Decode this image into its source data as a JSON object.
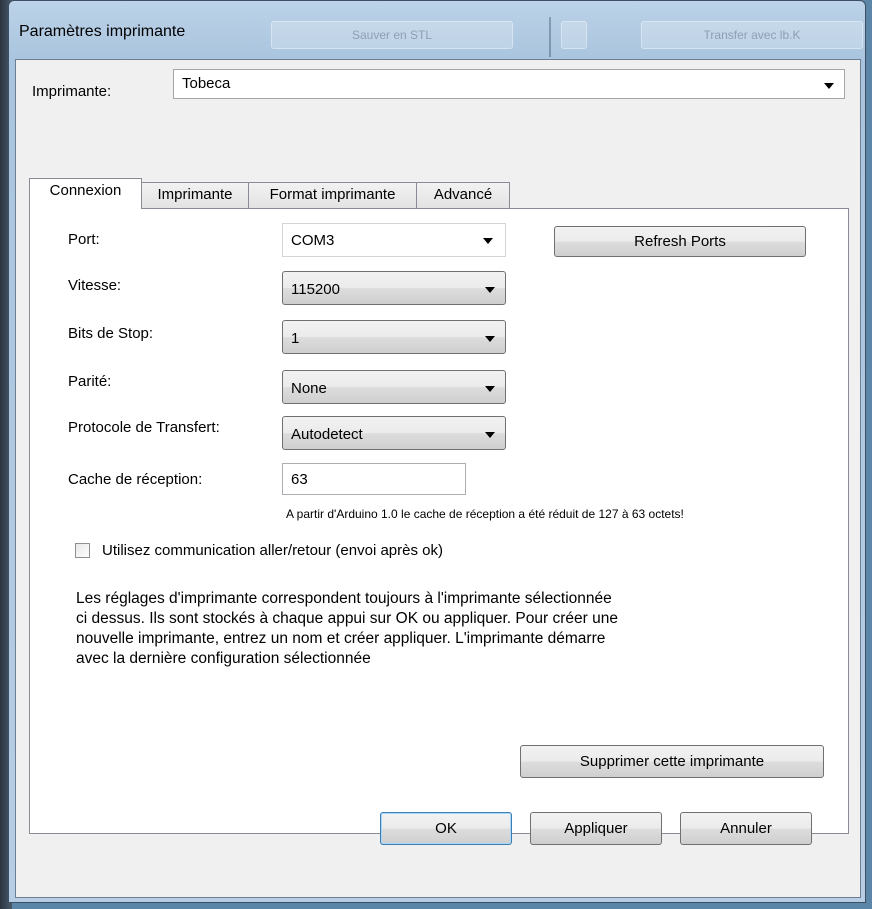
{
  "window": {
    "title": "Paramètres imprimante"
  },
  "background": {
    "ghost_tab_left": "Sauver en STL",
    "ghost_tab_right": "Transfer avec lb.K"
  },
  "printer": {
    "label": "Imprimante:",
    "selected": "Tobeca"
  },
  "tabs": [
    {
      "label": "Connexion"
    },
    {
      "label": "Imprimante"
    },
    {
      "label": "Format imprimante"
    },
    {
      "label": "Advancé"
    }
  ],
  "connection": {
    "port_label": "Port:",
    "port_value": "COM3",
    "refresh_button": "Refresh Ports",
    "speed_label": "Vitesse:",
    "speed_value": "115200",
    "stopbits_label": "Bits de Stop:",
    "stopbits_value": "1",
    "parity_label": "Parité:",
    "parity_value": "None",
    "protocol_label": "Protocole de Transfert:",
    "protocol_value": "Autodetect",
    "cache_label": "Cache de réception:",
    "cache_value": "63",
    "cache_note": "A partir d'Arduino 1.0 le cache de réception a été réduit de 127 à 63 octets!",
    "pingpong_label": "Utilisez communication aller/retour (envoi après ok)",
    "info_text": "Les réglages d'imprimante correspondent toujours à l'imprimante sélectionnée\nci dessus. Ils sont stockés à chaque appui sur OK ou appliquer. Pour créer une\nnouvelle imprimante, entrez un nom et créer appliquer. L'imprimante démarre\navec la dernière configuration sélectionnée",
    "delete_button": "Supprimer cette imprimante"
  },
  "footer": {
    "ok": "OK",
    "apply": "Appliquer",
    "cancel": "Annuler"
  },
  "colors": {
    "accent": "#3c7fb1",
    "window_frame": "#a9c4de"
  }
}
